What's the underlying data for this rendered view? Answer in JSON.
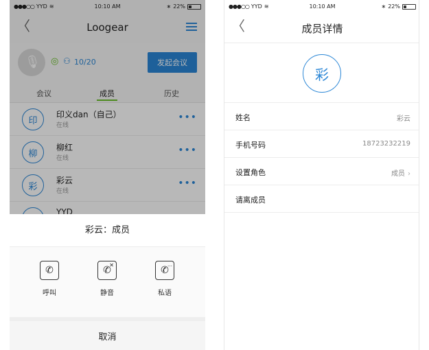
{
  "status_bar": {
    "carrier": "YYD",
    "time": "10:10 AM",
    "battery": "22%"
  },
  "left": {
    "nav": {
      "title": "Loogear",
      "back_glyph": "〈"
    },
    "room": {
      "count": "10/20",
      "start_button": "发起会议"
    },
    "tabs": [
      "会议",
      "成员",
      "历史"
    ],
    "members": [
      {
        "initial": "印",
        "name": "印义dan（自己）",
        "status": "在线"
      },
      {
        "initial": "柳",
        "name": "柳红",
        "status": "在线"
      },
      {
        "initial": "彩",
        "name": "彩云",
        "status": "在线"
      },
      {
        "initial": "",
        "name": "YYD",
        "status": ""
      }
    ],
    "sheet": {
      "title": "彩云：成员",
      "actions": [
        {
          "label": "呼叫",
          "icon": "phone-icon"
        },
        {
          "label": "静音",
          "icon": "phone-mute-icon"
        },
        {
          "label": "私语",
          "icon": "phone-chat-icon"
        }
      ],
      "cancel": "取消"
    }
  },
  "right": {
    "nav": {
      "title": "成员详情",
      "back_glyph": "〈"
    },
    "badge": "彩",
    "rows": [
      {
        "key": "姓名",
        "value": "彩云"
      },
      {
        "key": "手机号码",
        "value": "18723232219"
      },
      {
        "key": "设置角色",
        "value": "成员"
      },
      {
        "key": "请离成员",
        "value": ""
      }
    ]
  },
  "colors": {
    "accent": "#2a86d6",
    "active_tab": "#6bbf2a"
  }
}
